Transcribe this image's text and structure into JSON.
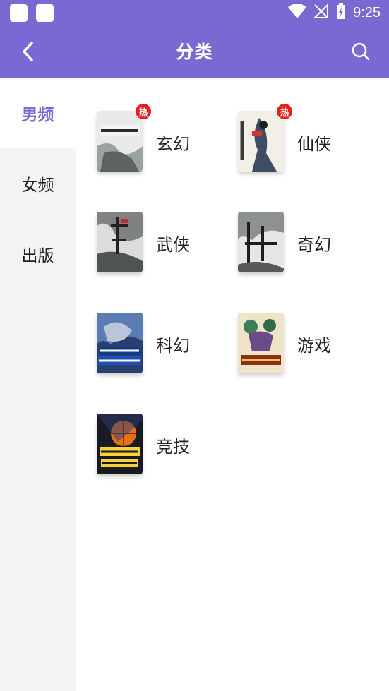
{
  "status_bar": {
    "time": "9:25"
  },
  "header": {
    "title": "分类"
  },
  "sidebar": {
    "items": [
      {
        "label": "男频"
      },
      {
        "label": "女频"
      },
      {
        "label": "出版"
      }
    ]
  },
  "categories": [
    {
      "label": "玄幻",
      "hot": "热"
    },
    {
      "label": "仙侠",
      "hot": "热"
    },
    {
      "label": "武侠"
    },
    {
      "label": "奇幻"
    },
    {
      "label": "科幻"
    },
    {
      "label": "游戏"
    },
    {
      "label": "竞技"
    }
  ],
  "colors": {
    "accent": "#7a69d3",
    "hot_badge": "#e8201a",
    "sidebar_bg": "#f4f4f6"
  }
}
